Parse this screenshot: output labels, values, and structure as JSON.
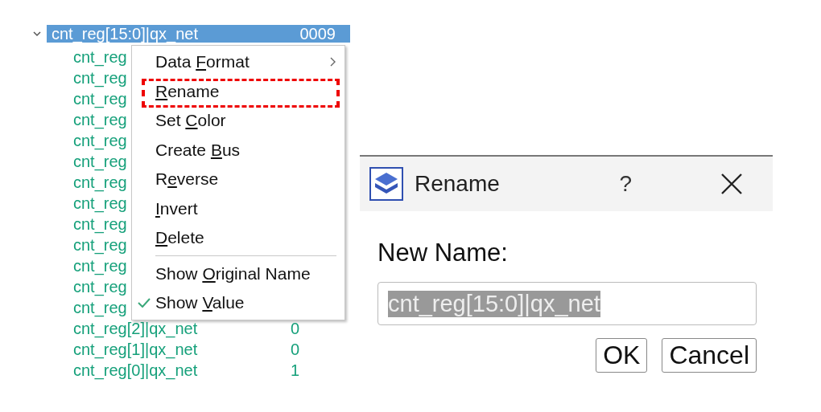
{
  "tree": {
    "root": {
      "label": "cnt_reg[15:0]|qx_net",
      "value": "0009",
      "expanded": true,
      "selected": true
    },
    "children": [
      {
        "label": "cnt_reg"
      },
      {
        "label": "cnt_reg"
      },
      {
        "label": "cnt_reg"
      },
      {
        "label": "cnt_reg"
      },
      {
        "label": "cnt_reg"
      },
      {
        "label": "cnt_reg"
      },
      {
        "label": "cnt_reg"
      },
      {
        "label": "cnt_reg"
      },
      {
        "label": "cnt_reg"
      },
      {
        "label": "cnt_reg"
      },
      {
        "label": "cnt_reg"
      },
      {
        "label": "cnt_reg"
      },
      {
        "label": "cnt_reg"
      },
      {
        "label": "cnt_reg[2]|qx_net",
        "value": "0"
      },
      {
        "label": "cnt_reg[1]|qx_net",
        "value": "0"
      },
      {
        "label": "cnt_reg[0]|qx_net",
        "value": "1"
      }
    ]
  },
  "context_menu": {
    "items": [
      {
        "kind": "item",
        "pre": "Data ",
        "key": "F",
        "post": "ormat",
        "submenu": true,
        "checked": false,
        "highlighted": false
      },
      {
        "kind": "item",
        "key": "R",
        "post": "ename",
        "submenu": false,
        "checked": false,
        "highlighted": true
      },
      {
        "kind": "item",
        "pre": "Set ",
        "key": "C",
        "post": "olor",
        "submenu": false,
        "checked": false,
        "highlighted": false
      },
      {
        "kind": "item",
        "pre": "Create ",
        "key": "B",
        "post": "us",
        "submenu": false,
        "checked": false,
        "highlighted": false
      },
      {
        "kind": "item",
        "pre": "R",
        "key": "e",
        "post": "verse",
        "submenu": false,
        "checked": false,
        "highlighted": false
      },
      {
        "kind": "item",
        "key": "I",
        "post": "nvert",
        "submenu": false,
        "checked": false,
        "highlighted": false
      },
      {
        "kind": "item",
        "key": "D",
        "post": "elete",
        "submenu": false,
        "checked": false,
        "highlighted": false
      },
      {
        "kind": "separator"
      },
      {
        "kind": "item",
        "pre": "Show ",
        "key": "O",
        "post": "riginal Name",
        "submenu": false,
        "checked": false,
        "highlighted": false
      },
      {
        "kind": "item",
        "pre": "Show ",
        "key": "V",
        "post": "alue",
        "submenu": false,
        "checked": true,
        "highlighted": false
      }
    ]
  },
  "dialog": {
    "title": "Rename",
    "help": "?",
    "field_label": "New Name:",
    "value": "cnt_reg[15:0]|qx_net",
    "value_selected": true,
    "buttons": [
      "OK",
      "Cancel"
    ]
  }
}
